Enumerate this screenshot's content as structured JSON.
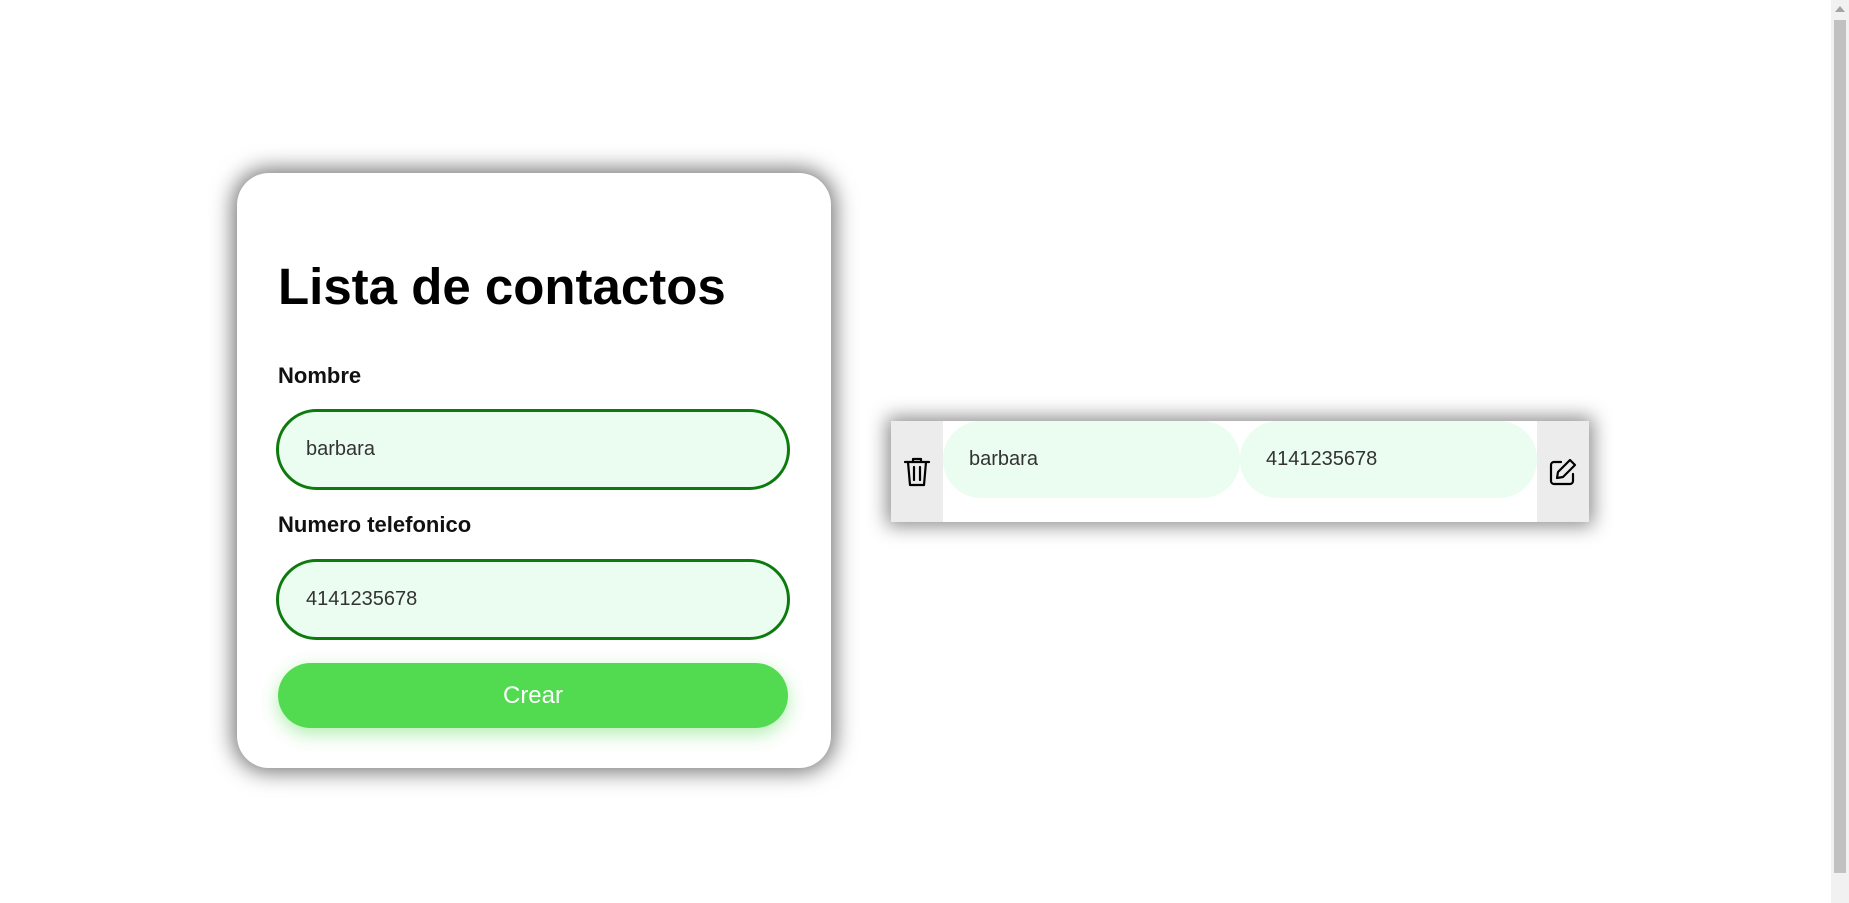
{
  "form": {
    "title": "Lista de contactos",
    "name_label": "Nombre",
    "name_value": "barbara",
    "phone_label": "Numero telefonico",
    "phone_value": "4141235678",
    "create_button": "Crear"
  },
  "contacts": [
    {
      "name": "barbara",
      "phone": "4141235678"
    }
  ],
  "icons": {
    "delete": "trash-icon",
    "edit": "edit-icon"
  },
  "colors": {
    "accent": "#52da50",
    "field_border": "#0d7a0d",
    "field_bg": "#eafdf0"
  }
}
